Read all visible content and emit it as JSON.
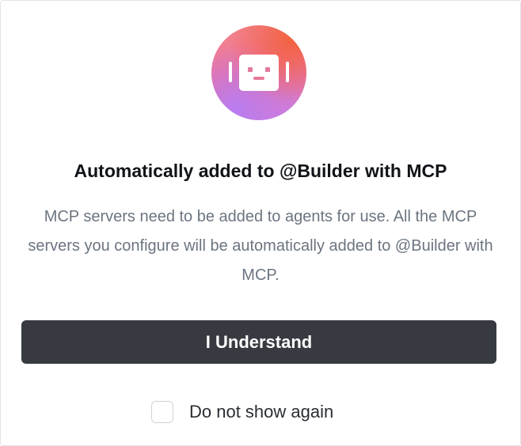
{
  "dialog": {
    "icon": "robot-icon",
    "title": "Automatically added to @Builder with MCP",
    "description": "MCP servers need to be added to agents for use. All the MCP servers you configure will be automatically added to @Builder with MCP.",
    "primary_button_label": "I Understand",
    "checkbox": {
      "label": "Do not show again",
      "checked": false
    }
  },
  "colors": {
    "button_background": "#373b41",
    "description_text": "#6b7480",
    "title_text": "#111418",
    "icon_gradient": [
      "#f48a8a",
      "#ee6f9b",
      "#f2633f",
      "#c880e8"
    ]
  }
}
